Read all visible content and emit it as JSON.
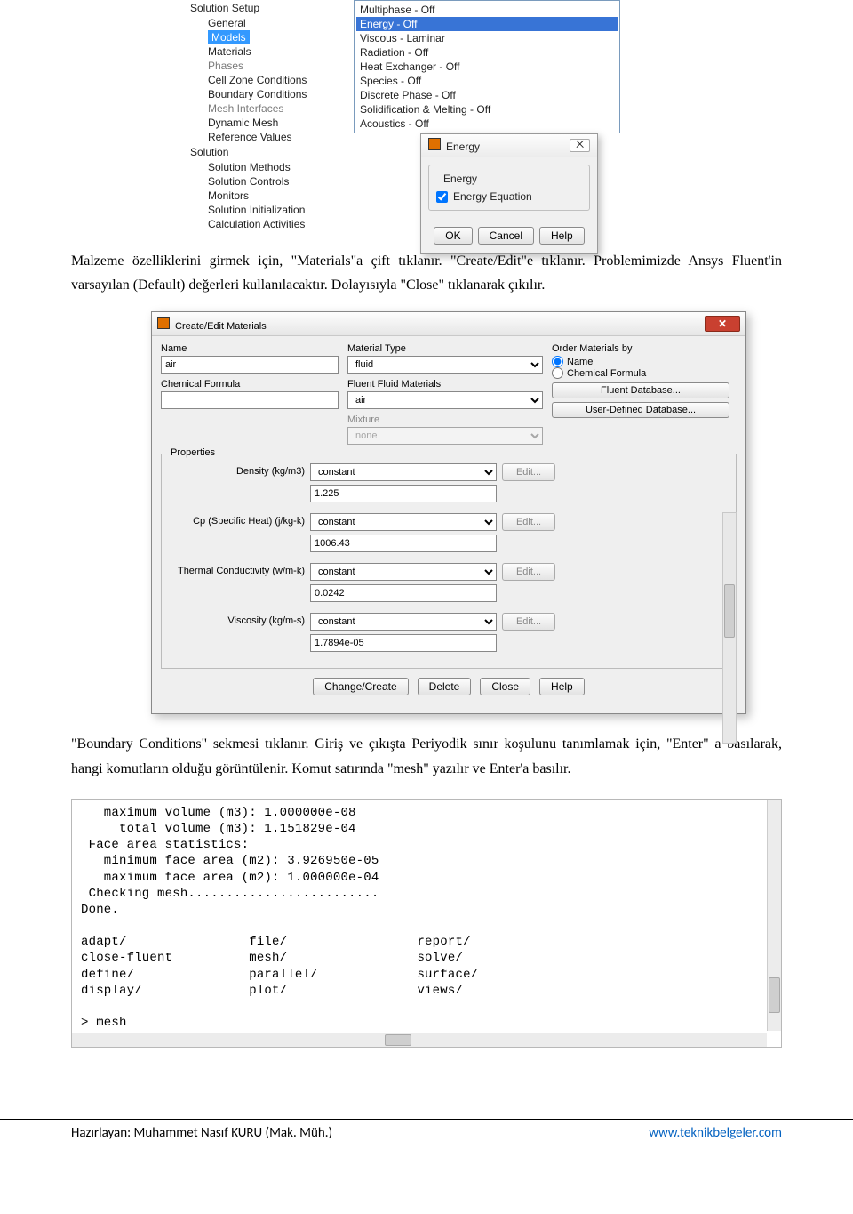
{
  "tree": {
    "header1": "Solution Setup",
    "items1": [
      "General",
      "Models",
      "Materials",
      "Phases",
      "Cell Zone Conditions",
      "Boundary Conditions",
      "Mesh Interfaces",
      "Dynamic Mesh",
      "Reference Values"
    ],
    "disabled1": [
      "Phases",
      "Mesh Interfaces"
    ],
    "selected1": "Models",
    "header2": "Solution",
    "items2": [
      "Solution Methods",
      "Solution Controls",
      "Monitors",
      "Solution Initialization",
      "Calculation Activities"
    ]
  },
  "models": {
    "items": [
      "Multiphase - Off",
      "Energy - Off",
      "Viscous - Laminar",
      "Radiation - Off",
      "Heat Exchanger - Off",
      "Species - Off",
      "Discrete Phase - Off",
      "Solidification & Melting - Off",
      "Acoustics - Off"
    ],
    "selected": "Energy - Off"
  },
  "energy_dialog": {
    "title": "Energy",
    "close_glyph": "⨉",
    "group_label": "Energy",
    "checkbox_label": "Energy Equation",
    "checked": true,
    "ok": "OK",
    "cancel": "Cancel",
    "help": "Help"
  },
  "para1": "Malzeme özelliklerini girmek için, \"Materials\"a çift tıklanır. \"Create/Edit\"e tıklanır. Problemimizde Ansys Fluent'in varsayılan (Default) değerleri kullanılacaktır. Dolayısıyla \"Close\" tıklanarak çıkılır.",
  "materials": {
    "title": "Create/Edit Materials",
    "name_label": "Name",
    "name_value": "air",
    "chem_label": "Chemical Formula",
    "chem_value": "",
    "mat_type_label": "Material Type",
    "mat_type_value": "fluid",
    "fluent_mat_label": "Fluent Fluid Materials",
    "fluent_mat_value": "air",
    "mixture_label": "Mixture",
    "mixture_value": "none",
    "order_label": "Order Materials by",
    "order_name": "Name",
    "order_chem": "Chemical Formula",
    "fluent_db_btn": "Fluent Database...",
    "user_db_btn": "User-Defined Database...",
    "props_title": "Properties",
    "props": [
      {
        "label": "Density (kg/m3)",
        "method": "constant",
        "value": "1.225"
      },
      {
        "label": "Cp (Specific Heat) (j/kg-k)",
        "method": "constant",
        "value": "1006.43"
      },
      {
        "label": "Thermal Conductivity (w/m-k)",
        "method": "constant",
        "value": "0.0242"
      },
      {
        "label": "Viscosity (kg/m-s)",
        "method": "constant",
        "value": "1.7894e-05"
      }
    ],
    "edit_btn": "Edit...",
    "buttons": {
      "change": "Change/Create",
      "delete": "Delete",
      "close": "Close",
      "help": "Help"
    }
  },
  "para2": "\"Boundary Conditions\" sekmesi tıklanır. Giriş ve çıkışta Periyodik sınır koşulunu tanımlamak için, \"Enter\" a basılarak, hangi komutların olduğu görüntülenir. Komut satırında \"mesh\" yazılır ve Enter'a basılır.",
  "console": {
    "lines": [
      "   maximum volume (m3): 1.000000e-08",
      "     total volume (m3): 1.151829e-04",
      " Face area statistics:",
      "   minimum face area (m2): 3.926950e-05",
      "   maximum face area (m2): 1.000000e-04",
      " Checking mesh.........................",
      "Done.",
      "",
      "adapt/                file/                 report/",
      "close-fluent          mesh/                 solve/",
      "define/               parallel/             surface/",
      "display/              plot/                 views/",
      "",
      "> mesh"
    ]
  },
  "footer": {
    "left_label": "Hazırlayan:",
    "left_name": " Muhammet Nasıf KURU (Mak. Müh.)",
    "right": "www.teknikbelgeler.com"
  }
}
